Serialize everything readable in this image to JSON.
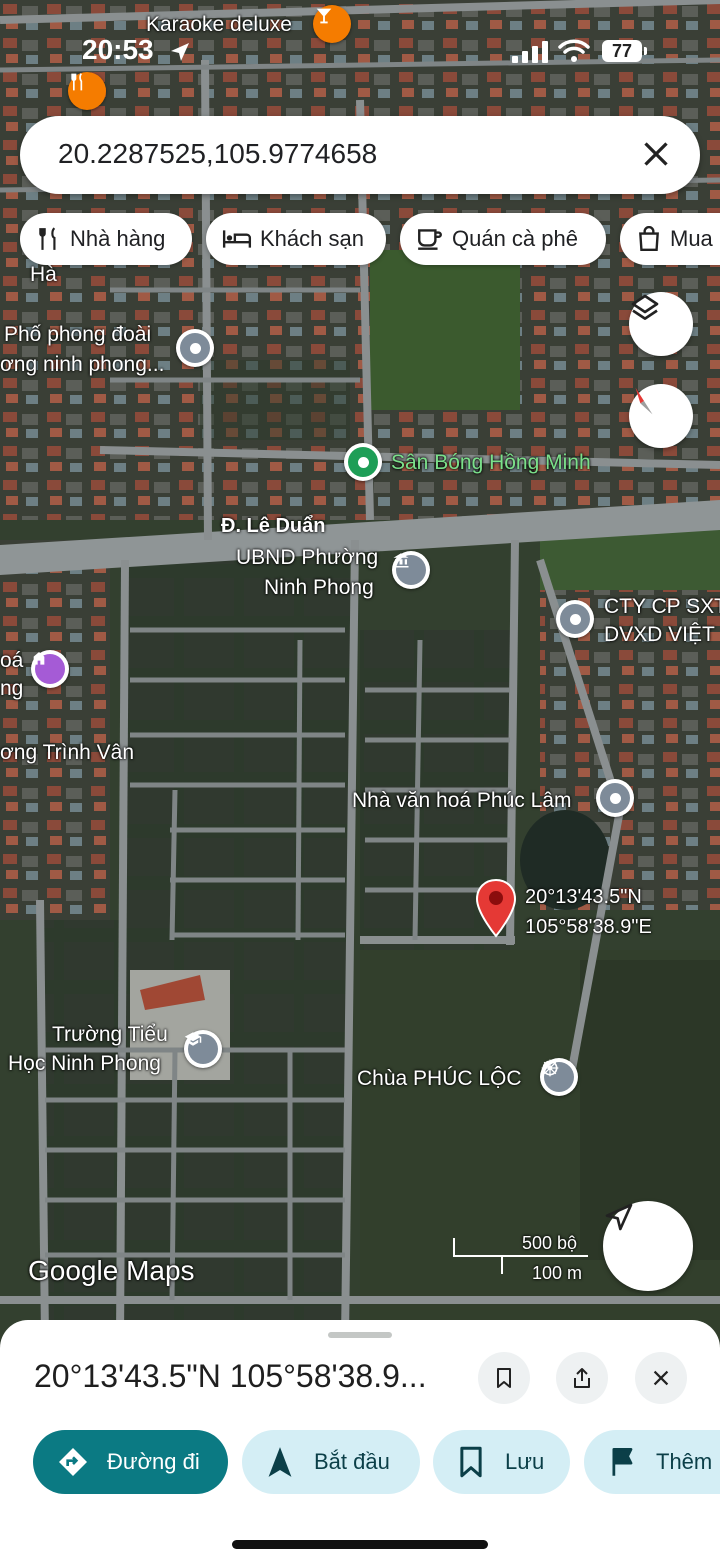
{
  "status_bar": {
    "time": "20:53",
    "battery": "77"
  },
  "search": {
    "query": "20.2287525,105.9774658"
  },
  "chips": [
    {
      "label": "Nhà hàng",
      "icon": "restaurant-icon"
    },
    {
      "label": "Khách sạn",
      "icon": "hotel-icon"
    },
    {
      "label": "Quán cà phê",
      "icon": "cafe-icon"
    },
    {
      "label": "Mua",
      "icon": "shopping-icon"
    }
  ],
  "map": {
    "places": {
      "karaoke": "Karaoke deluxe",
      "pho_phong_1": "Phố phong đoài",
      "pho_phong_2": "ơng ninh phong...",
      "stadium": "Sân Bóng Hồng Minh",
      "street_ha": "Hà",
      "le_duan": "Đ. Lê Duẩn",
      "ubnd_1": "UBND Phường",
      "ubnd_2": "Ninh Phong",
      "cty_1": "CTY CP SXT",
      "cty_2": "DVXD VIỆT",
      "hoa": "oá",
      "ng": "ng",
      "trinh_van": "ơng Trình Vân",
      "van_hoa": "Nhà văn hoá Phúc Lâm",
      "pin_lat": "20°13'43.5\"N",
      "pin_lng": "105°58'38.9\"E",
      "school_1": "Trường Tiểu",
      "school_2": "Học Ninh Phong",
      "pagoda": "Chùa PHÚC LỘC"
    },
    "scale": {
      "feet": "500 bộ",
      "meters": "100 m"
    },
    "logo": "Google Maps"
  },
  "sheet": {
    "title": "20°13'43.5\"N 105°58'38.9...",
    "actions": [
      {
        "label": "Đường đi",
        "icon": "directions-icon"
      },
      {
        "label": "Bắt đầu",
        "icon": "navigation-arrow-icon"
      },
      {
        "label": "Lưu",
        "icon": "bookmark-icon"
      },
      {
        "label": "Thêm",
        "icon": "flag-icon"
      }
    ]
  },
  "colors": {
    "accent": "#0b7a83",
    "action_bg": "#d4eef5",
    "pin_red": "#e53935"
  }
}
